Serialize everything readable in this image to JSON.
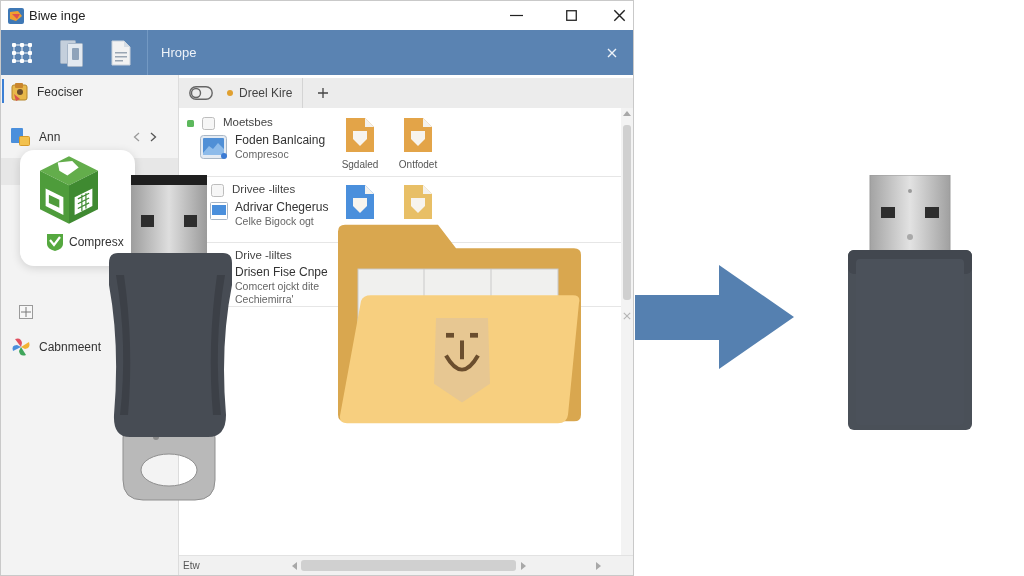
{
  "window": {
    "title": "Biwe inge"
  },
  "toolbar": {
    "title": "Hrope"
  },
  "sidebar": {
    "items": [
      {
        "label": "Feociser",
        "selected": true
      },
      {
        "label": "Ann",
        "selected": false
      },
      {
        "label": "Cabnmeent",
        "selected": false
      }
    ]
  },
  "card": {
    "label": "Compresx"
  },
  "tab": {
    "label": "Dreel Kire"
  },
  "rows": [
    {
      "heading": "Moetsbes",
      "color": "#5cb85c",
      "checked": false,
      "title": "Foden Banlcaing",
      "lines": [
        "Compresoc"
      ],
      "files": [
        {
          "label": "Sgdaled",
          "color": "#e3a448"
        },
        {
          "label": "Ontfodet",
          "color": "#e3a448"
        }
      ]
    },
    {
      "heading": "Drivee -liltes",
      "checked": false,
      "title": "Adrivar Chegerus",
      "lines": [
        "Celke Bigock ogt"
      ],
      "files": [
        {
          "color": "#4a8fdc"
        },
        {
          "color": "#e8bf66"
        }
      ]
    },
    {
      "heading": "Drive -liltes",
      "title": "Drisen Fise Cnpe",
      "lines": [
        "Comcert ojckt dite",
        "Cechiemirra'"
      ]
    }
  ],
  "status_bar": {
    "label": "Etw"
  }
}
